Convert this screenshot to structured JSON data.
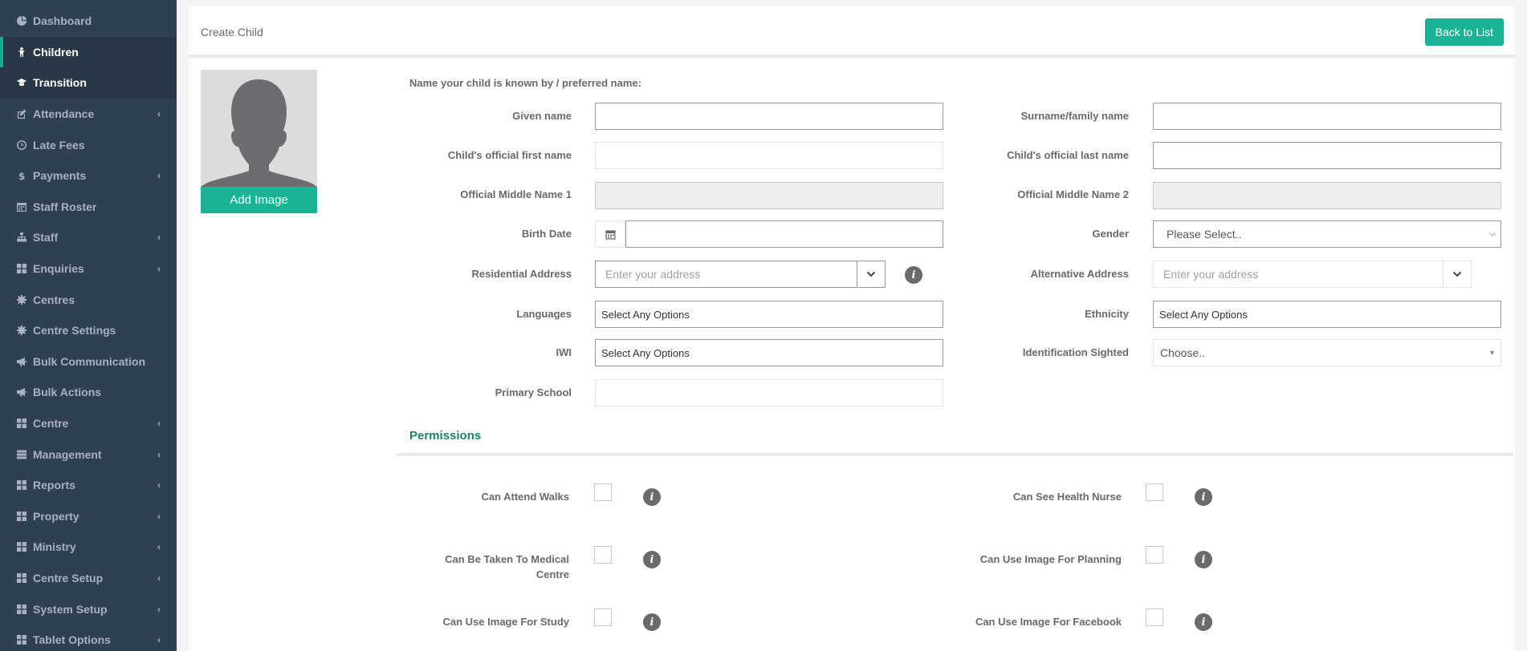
{
  "sidebar": {
    "items": [
      {
        "label": "Dashboard",
        "icon": "pie-chart-icon",
        "chevron": false,
        "state": "normal"
      },
      {
        "label": "Children",
        "icon": "child-icon",
        "chevron": false,
        "state": "active"
      },
      {
        "label": "Transition",
        "icon": "graduation-cap-icon",
        "chevron": false,
        "state": "child"
      },
      {
        "label": "Attendance",
        "icon": "edit-icon",
        "chevron": true,
        "state": "normal"
      },
      {
        "label": "Late Fees",
        "icon": "clock-icon",
        "chevron": false,
        "state": "normal"
      },
      {
        "label": "Payments",
        "icon": "dollar-icon",
        "chevron": true,
        "state": "normal"
      },
      {
        "label": "Staff Roster",
        "icon": "calendar-icon",
        "chevron": false,
        "state": "normal"
      },
      {
        "label": "Staff",
        "icon": "sitemap-icon",
        "chevron": true,
        "state": "normal"
      },
      {
        "label": "Enquiries",
        "icon": "grid-icon",
        "chevron": true,
        "state": "normal"
      },
      {
        "label": "Centres",
        "icon": "cog-icon",
        "chevron": false,
        "state": "normal"
      },
      {
        "label": "Centre Settings",
        "icon": "cog-icon",
        "chevron": false,
        "state": "normal"
      },
      {
        "label": "Bulk Communication",
        "icon": "bullhorn-icon",
        "chevron": false,
        "state": "normal"
      },
      {
        "label": "Bulk Actions",
        "icon": "bullhorn-icon",
        "chevron": false,
        "state": "normal"
      },
      {
        "label": "Centre",
        "icon": "grid-icon",
        "chevron": true,
        "state": "normal"
      },
      {
        "label": "Management",
        "icon": "tasks-icon",
        "chevron": true,
        "state": "normal"
      },
      {
        "label": "Reports",
        "icon": "grid-icon",
        "chevron": true,
        "state": "normal"
      },
      {
        "label": "Property",
        "icon": "grid-icon",
        "chevron": true,
        "state": "normal"
      },
      {
        "label": "Ministry",
        "icon": "grid-icon",
        "chevron": true,
        "state": "normal"
      },
      {
        "label": "Centre Setup",
        "icon": "grid-icon",
        "chevron": true,
        "state": "normal"
      },
      {
        "label": "System Setup",
        "icon": "grid-icon",
        "chevron": true,
        "state": "normal"
      },
      {
        "label": "Tablet Options",
        "icon": "grid-icon",
        "chevron": true,
        "state": "normal"
      }
    ]
  },
  "header": {
    "title": "Create Child",
    "back_button": "Back to List"
  },
  "avatar": {
    "add_image_label": "Add Image"
  },
  "form": {
    "preferred_name_label": "Name your child is known by / preferred name:",
    "given_name": {
      "label": "Given name",
      "value": ""
    },
    "surname": {
      "label": "Surname/family name",
      "value": ""
    },
    "official_first": {
      "label": "Child's official first name",
      "value": ""
    },
    "official_last": {
      "label": "Child's official last name",
      "value": ""
    },
    "middle1": {
      "label": "Official Middle Name 1",
      "value": ""
    },
    "middle2": {
      "label": "Official Middle Name 2",
      "value": ""
    },
    "birth_date": {
      "label": "Birth Date",
      "value": ""
    },
    "gender": {
      "label": "Gender",
      "value": "Please Select.."
    },
    "residential_address": {
      "label": "Residential Address",
      "placeholder": "Enter your address"
    },
    "alternative_address": {
      "label": "Alternative Address",
      "placeholder": "Enter your address"
    },
    "languages": {
      "label": "Languages",
      "value": "Select Any Options"
    },
    "ethnicity": {
      "label": "Ethnicity",
      "value": "Select Any Options"
    },
    "iwi": {
      "label": "IWI",
      "value": "Select Any Options"
    },
    "identification": {
      "label": "Identification Sighted",
      "value": "Choose.."
    },
    "primary_school": {
      "label": "Primary School",
      "value": ""
    }
  },
  "permissions": {
    "title": "Permissions",
    "left": [
      {
        "label": "Can Attend Walks",
        "checked": false
      },
      {
        "label": "Can Be Taken To Medical Centre",
        "checked": false
      },
      {
        "label": "Can Use Image For Study",
        "checked": false
      }
    ],
    "right": [
      {
        "label": "Can See Health Nurse",
        "checked": false
      },
      {
        "label": "Can Use Image For Planning",
        "checked": false
      },
      {
        "label": "Can Use Image For Facebook",
        "checked": false
      }
    ]
  },
  "colors": {
    "sidebar_bg": "#2f4050",
    "accent": "#1ab394",
    "permissions_title": "#1c7f69"
  }
}
